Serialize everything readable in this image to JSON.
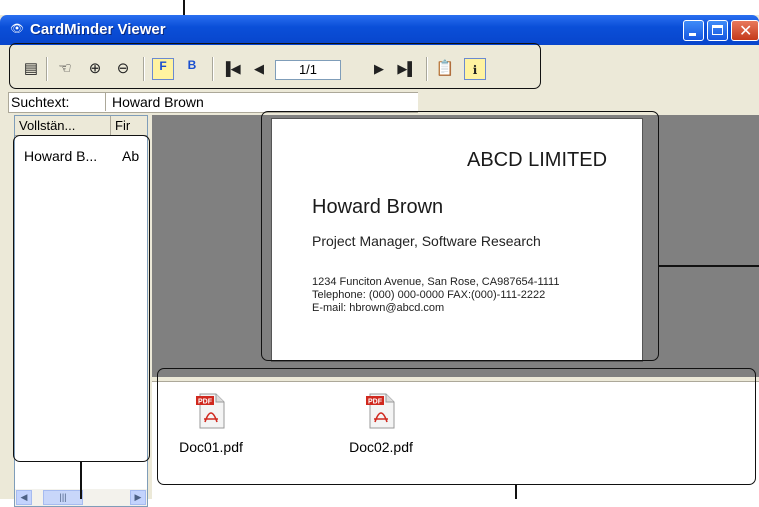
{
  "window": {
    "title": "CardMinder Viewer",
    "title_icon": "eye-icon"
  },
  "toolbar": {
    "page_indicator": "1/1",
    "icons": [
      "form-view-icon",
      "hand-pan-icon",
      "zoom-in-icon",
      "zoom-out-icon",
      "front-side-icon",
      "back-side-icon",
      "first-page-icon",
      "previous-page-icon",
      "next-page-icon",
      "last-page-icon",
      "copy-clipboard-icon",
      "card-info-icon"
    ]
  },
  "search": {
    "label": "Suchtext:",
    "value": "Howard Brown"
  },
  "list": {
    "columns": [
      "Vollstän...",
      "Fir"
    ],
    "rows": [
      {
        "full_name": "Howard B...",
        "company": "Ab"
      }
    ]
  },
  "card": {
    "company": "ABCD LIMITED",
    "name": "Howard Brown",
    "role": "Project Manager, Software Research",
    "address": "1234 Funciton Avenue, San Rose, CA987654-1111",
    "phone": "Telephone: (000) 000-0000  FAX:(000)-111-2222",
    "email": "E-mail: hbrown@abcd.com"
  },
  "files": [
    {
      "name": "Doc01.pdf",
      "icon": "pdf-file-icon"
    },
    {
      "name": "Doc02.pdf",
      "icon": "pdf-file-icon"
    }
  ],
  "colors": {
    "titlebar": "#0a4fd8",
    "window_bg": "#ece9d8",
    "preview_bg": "#808080",
    "pdf_red": "#d0281e"
  }
}
